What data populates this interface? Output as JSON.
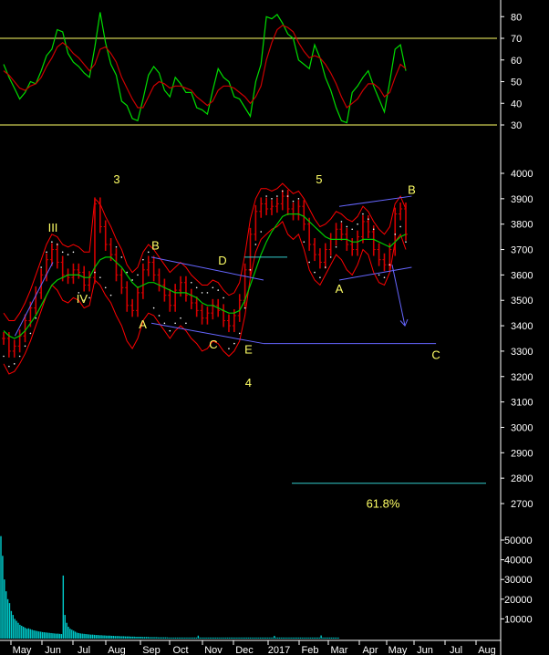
{
  "colors": {
    "background": "#000000",
    "axis_text": "#ffffff",
    "price_bars": "#d40000",
    "indicator_fast": "#00dd00",
    "indicator_slow": "#cc0000",
    "bollinger": "#ff0000",
    "moving_average": "#00cc00",
    "sar_dots": "#ffffff",
    "reference_lines": "#ffff66",
    "trend_lines": "#6666ff",
    "target_line": "#33cccc",
    "wave_labels": "#ffff66",
    "volume_bars": "#00cccc"
  },
  "chart_data": [
    {
      "type": "line",
      "panel": "oscillator",
      "y_ticks": [
        "80",
        "70",
        "60",
        "50",
        "40",
        "30"
      ],
      "ylim": [
        26,
        86
      ],
      "reference_levels": [
        70,
        30
      ],
      "series": [
        {
          "values": [
            58,
            52,
            47,
            42,
            45,
            50,
            49,
            55,
            62,
            65,
            74,
            73,
            63,
            59,
            57,
            54,
            52,
            66,
            82,
            68,
            58,
            53,
            41,
            39,
            33,
            32,
            42,
            53,
            57,
            54,
            46,
            43,
            52,
            49,
            45,
            45,
            38,
            37,
            35,
            46,
            56,
            52,
            50,
            43,
            42,
            38,
            34,
            50,
            58,
            80,
            79,
            81,
            77,
            72,
            70,
            60,
            58,
            56,
            67,
            61,
            52,
            46,
            38,
            32,
            31,
            45,
            48,
            52,
            55,
            48,
            42,
            36,
            50,
            65,
            67,
            55
          ]
        },
        {
          "values": [
            55,
            53,
            50,
            47,
            46,
            48,
            49,
            52,
            57,
            61,
            66,
            68,
            66,
            63,
            61,
            58,
            55,
            58,
            65,
            66,
            63,
            59,
            52,
            47,
            42,
            38,
            38,
            43,
            48,
            50,
            49,
            47,
            48,
            48,
            47,
            46,
            43,
            41,
            39,
            41,
            46,
            48,
            48,
            47,
            45,
            43,
            40,
            43,
            48,
            60,
            68,
            74,
            76,
            75,
            73,
            68,
            64,
            61,
            62,
            61,
            58,
            54,
            49,
            43,
            38,
            40,
            42,
            46,
            49,
            49,
            47,
            43,
            45,
            52,
            58,
            56
          ]
        }
      ]
    },
    {
      "type": "line",
      "panel": "price",
      "y_ticks": [
        "4000",
        "3900",
        "3800",
        "3700",
        "3600",
        "3500",
        "3400",
        "3300",
        "3200",
        "3100",
        "3000",
        "2900",
        "2800",
        "2700"
      ],
      "ylim": [
        2630,
        4080
      ],
      "x_ticks": [
        "May",
        "Jun",
        "Jul",
        "Aug",
        "Sep",
        "Oct",
        "Nov",
        "Dec",
        "2017",
        "Feb",
        "Mar",
        "Apr",
        "May",
        "Jun",
        "Jul",
        "Aug"
      ],
      "series": [
        {
          "values": [
            3350,
            3300,
            3320,
            3360,
            3420,
            3470,
            3530,
            3600,
            3660,
            3700,
            3650,
            3600,
            3590,
            3620,
            3610,
            3560,
            3590,
            3880,
            3790,
            3720,
            3680,
            3600,
            3550,
            3480,
            3460,
            3530,
            3620,
            3650,
            3600,
            3560,
            3520,
            3480,
            3540,
            3570,
            3520,
            3490,
            3460,
            3430,
            3450,
            3480,
            3460,
            3420,
            3400,
            3440,
            3500,
            3620,
            3760,
            3850,
            3880,
            3860,
            3870,
            3880,
            3910,
            3860,
            3840,
            3870,
            3800,
            3720,
            3680,
            3650,
            3700,
            3740,
            3780,
            3760,
            3720,
            3700,
            3750,
            3810,
            3770,
            3700,
            3660,
            3640,
            3700,
            3840,
            3860,
            3760
          ]
        },
        {
          "values": [
            3380,
            3360,
            3350,
            3360,
            3380,
            3410,
            3440,
            3480,
            3520,
            3560,
            3580,
            3590,
            3600,
            3600,
            3600,
            3590,
            3590,
            3630,
            3660,
            3670,
            3670,
            3650,
            3630,
            3600,
            3570,
            3550,
            3560,
            3570,
            3570,
            3560,
            3550,
            3540,
            3530,
            3530,
            3530,
            3520,
            3510,
            3490,
            3480,
            3480,
            3470,
            3460,
            3450,
            3450,
            3460,
            3500,
            3560,
            3620,
            3680,
            3730,
            3770,
            3800,
            3830,
            3840,
            3840,
            3840,
            3830,
            3810,
            3790,
            3770,
            3750,
            3740,
            3740,
            3740,
            3740,
            3730,
            3730,
            3740,
            3740,
            3740,
            3730,
            3720,
            3710,
            3730,
            3750,
            3760
          ]
        },
        {
          "values": [
            3450,
            3420,
            3420,
            3450,
            3490,
            3540,
            3600,
            3660,
            3720,
            3760,
            3750,
            3720,
            3710,
            3720,
            3710,
            3690,
            3690,
            3900,
            3880,
            3830,
            3790,
            3740,
            3700,
            3640,
            3610,
            3630,
            3690,
            3720,
            3700,
            3670,
            3640,
            3610,
            3630,
            3650,
            3630,
            3600,
            3580,
            3560,
            3560,
            3580,
            3570,
            3540,
            3520,
            3530,
            3570,
            3680,
            3820,
            3900,
            3940,
            3940,
            3930,
            3940,
            3960,
            3940,
            3920,
            3930,
            3900,
            3860,
            3820,
            3790,
            3800,
            3820,
            3850,
            3840,
            3820,
            3810,
            3830,
            3870,
            3850,
            3810,
            3780,
            3760,
            3790,
            3880,
            3910,
            3860
          ]
        },
        {
          "values": [
            3250,
            3210,
            3220,
            3250,
            3290,
            3340,
            3400,
            3460,
            3520,
            3560,
            3540,
            3500,
            3490,
            3510,
            3500,
            3470,
            3480,
            3580,
            3560,
            3520,
            3490,
            3440,
            3400,
            3340,
            3310,
            3350,
            3420,
            3450,
            3440,
            3410,
            3380,
            3350,
            3380,
            3400,
            3380,
            3350,
            3330,
            3300,
            3310,
            3340,
            3330,
            3300,
            3280,
            3300,
            3340,
            3440,
            3590,
            3690,
            3740,
            3760,
            3780,
            3790,
            3810,
            3760,
            3740,
            3760,
            3700,
            3620,
            3580,
            3560,
            3600,
            3640,
            3680,
            3660,
            3620,
            3600,
            3640,
            3700,
            3680,
            3610,
            3570,
            3560,
            3610,
            3730,
            3760,
            3700
          ]
        }
      ],
      "trend_lines": [
        {
          "from": [
            "Apr 25",
            3360
          ],
          "to": [
            "Jun 01",
            3650
          ]
        },
        {
          "from": [
            "Sep 01",
            3410
          ],
          "to": [
            "Dec 20",
            3330
          ]
        },
        {
          "from": [
            "Sep 01",
            3670
          ],
          "to": [
            "Dec 20",
            3580
          ]
        },
        {
          "from": [
            "Dec 20",
            3330
          ],
          "to": [
            "Jun 12",
            3330
          ]
        },
        {
          "from": [
            "Mar 01",
            3580
          ],
          "to": [
            "May 15",
            3630
          ]
        },
        {
          "from": [
            "Mar 01",
            3870
          ],
          "to": [
            "May 15",
            3910
          ]
        }
      ],
      "target_line": {
        "level": 2780,
        "label": "61.8%"
      },
      "annotations": [
        {
          "text": "III",
          "date": "Jun 01",
          "price": 3770
        },
        {
          "text": "IV",
          "date": "Jun 30",
          "price": 3490
        },
        {
          "text": "3",
          "date": "Aug 01",
          "price": 3960
        },
        {
          "text": "A",
          "date": "Aug 27",
          "price": 3390
        },
        {
          "text": "B",
          "date": "Sep 05",
          "price": 3700
        },
        {
          "text": "C",
          "date": "Nov 01",
          "price": 3310
        },
        {
          "text": "D",
          "date": "Nov 10",
          "price": 3640
        },
        {
          "text": "E",
          "date": "Dec 05",
          "price": 3290
        },
        {
          "text": "4",
          "date": "Dec 05",
          "price": 3160
        },
        {
          "text": "5",
          "date": "Feb 10",
          "price": 3960
        },
        {
          "text": "A",
          "date": "Mar 01",
          "price": 3530
        },
        {
          "text": "B",
          "date": "May 15",
          "price": 3920
        },
        {
          "text": "C",
          "date": "Jun 12",
          "price": 3270
        }
      ]
    },
    {
      "type": "bar",
      "panel": "volume",
      "y_ticks": [
        "50000",
        "40000",
        "30000",
        "20000",
        "10000"
      ],
      "ylim": [
        0,
        58000
      ],
      "values": [
        52000,
        42000,
        30000,
        24000,
        20000,
        18000,
        14000,
        12000,
        10000,
        9000,
        8000,
        7000,
        6500,
        6000,
        5500,
        5000,
        5200,
        4800,
        4500,
        4200,
        4000,
        3800,
        3600,
        3500,
        3300,
        3200,
        3100,
        3000,
        2900,
        2800,
        2700,
        2600,
        2500,
        2500,
        2400,
        2300,
        32000,
        12000,
        8000,
        6000,
        5000,
        4500,
        4000,
        3500,
        3000,
        2800,
        2600,
        2500,
        2400,
        2300,
        2200,
        2100,
        2000,
        2000,
        1900,
        1800,
        1800,
        1700,
        1700,
        1600,
        1600,
        1500,
        1500,
        1500,
        1400,
        1400,
        1300,
        1300,
        1300,
        1200,
        1200,
        1200,
        1100,
        1100,
        1100,
        1000,
        1000,
        1000,
        900,
        900,
        900,
        900,
        800,
        800,
        800,
        800,
        700,
        700,
        700,
        700,
        700,
        600,
        600,
        600,
        600,
        600,
        600,
        500,
        500,
        500,
        500,
        500,
        500,
        500,
        500,
        500,
        500,
        500,
        500,
        500,
        500,
        500,
        500,
        500,
        1500,
        500,
        500,
        500,
        500,
        500,
        500,
        500,
        500,
        500,
        500,
        500,
        500,
        500,
        500,
        500,
        500,
        500,
        500,
        500,
        500,
        500,
        500,
        500,
        500,
        500,
        500,
        500,
        500,
        500,
        500,
        500,
        500,
        500,
        500,
        500,
        500,
        500,
        500,
        500,
        500,
        500,
        500,
        500,
        1400,
        500,
        500,
        500,
        500,
        500,
        500,
        500,
        500,
        500,
        500,
        500,
        500,
        500,
        500,
        500,
        500,
        500,
        500,
        500,
        500,
        500,
        500,
        500,
        500,
        500,
        500,
        1600,
        500,
        500,
        500,
        500,
        500,
        500,
        500,
        500,
        500,
        500
      ]
    }
  ]
}
